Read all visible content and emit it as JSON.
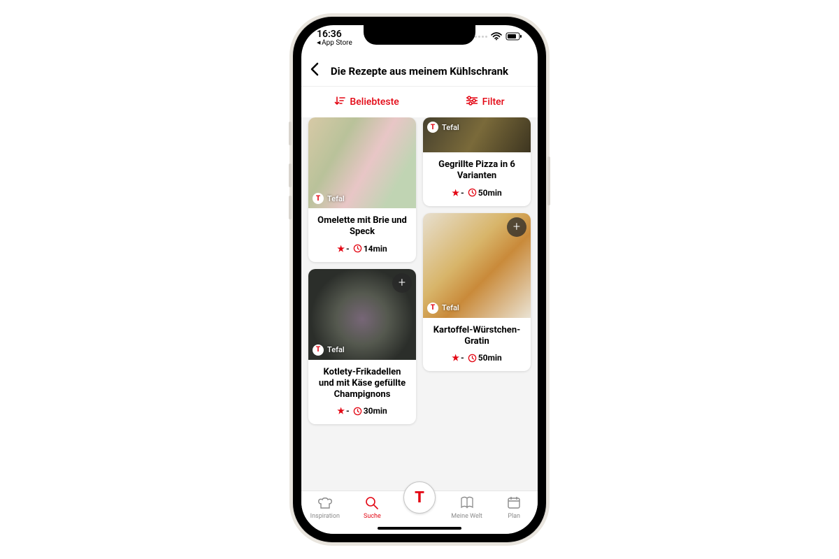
{
  "status": {
    "time": "16:36",
    "back_app": "App Store"
  },
  "header": {
    "title": "Die Rezepte aus meinem Kühlschrank"
  },
  "toolbar": {
    "sort_label": "Beliebteste",
    "filter_label": "Filter"
  },
  "brand": {
    "logo_letter": "T",
    "name": "Tefal"
  },
  "recipes": {
    "r1": {
      "title": "Omelette mit Brie und Speck",
      "rating": "-",
      "time": "14min"
    },
    "r2": {
      "title": "Gegrillte Pizza in 6 Varianten",
      "rating": "-",
      "time": "50min"
    },
    "r3": {
      "title": "Kotlety-Frikadellen und mit Käse gefüllte Champignons",
      "rating": "-",
      "time": "30min"
    },
    "r4": {
      "title": "Kartoffel-Würstchen-Gratin",
      "rating": "-",
      "time": "50min"
    }
  },
  "tabs": {
    "inspiration": "Inspiration",
    "search": "Suche",
    "center_letter": "T",
    "meinewelt": "Meine Welt",
    "plan": "Plan"
  },
  "colors": {
    "accent": "#e30613"
  }
}
